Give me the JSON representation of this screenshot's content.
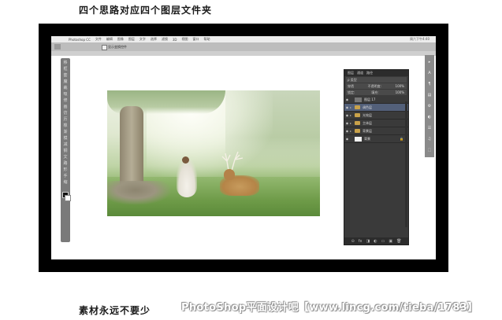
{
  "captions": {
    "top": "四个思路对应四个图层文件夹",
    "bottom": "素材永远不要少",
    "watermark": "PhotoShop平面设计吧【www.lincg.com/tieba/1783】"
  },
  "photoshop": {
    "menubar": {
      "app_name": "Photoshop CC",
      "items": [
        "文件",
        "编辑",
        "图像",
        "图层",
        "文字",
        "选择",
        "滤镜",
        "3D",
        "视图",
        "窗口",
        "帮助"
      ],
      "clock": "周六下午4:40"
    },
    "options_bar": {
      "label": "显示变换控件"
    },
    "left_tools": [
      "移",
      "框",
      "套",
      "魔",
      "裁",
      "吸",
      "修",
      "画",
      "仿",
      "历",
      "橡",
      "渐",
      "模",
      "减",
      "钢",
      "文",
      "路",
      "形",
      "手",
      "缩"
    ],
    "right_tools": [
      "▸",
      "A",
      "¶",
      "▤",
      "⚙",
      "◐",
      "☰",
      "♫",
      "⬚"
    ],
    "layers_panel": {
      "tabs": [
        "图层",
        "通道",
        "路径"
      ],
      "filter": {
        "label": "ρ 类型",
        "value": ""
      },
      "blend": {
        "mode": "穿透",
        "opacity_label": "不透明度:",
        "opacity": "100%"
      },
      "lock": {
        "label": "锁定:",
        "fill_label": "填充:",
        "fill": "100%"
      },
      "layers": [
        {
          "eye": "◉",
          "name": "图层 17",
          "type": "thumb",
          "selected": false,
          "caret": ""
        },
        {
          "eye": "◉",
          "name": "调色层",
          "type": "folder",
          "selected": true,
          "caret": "▸"
        },
        {
          "eye": "◉",
          "name": "光效层",
          "type": "folder",
          "selected": false,
          "caret": "▸"
        },
        {
          "eye": "◉",
          "name": "主体层",
          "type": "folder",
          "selected": false,
          "caret": "▸"
        },
        {
          "eye": "◉",
          "name": "背景层",
          "type": "folder",
          "selected": false,
          "caret": "▸"
        },
        {
          "eye": "◉",
          "name": "背景",
          "type": "white",
          "selected": false,
          "caret": "",
          "lock": "🔒"
        }
      ],
      "bottom_icons": [
        "⊝",
        "fx",
        "◨",
        "◐",
        "▭",
        "▣",
        "🗑"
      ]
    }
  }
}
